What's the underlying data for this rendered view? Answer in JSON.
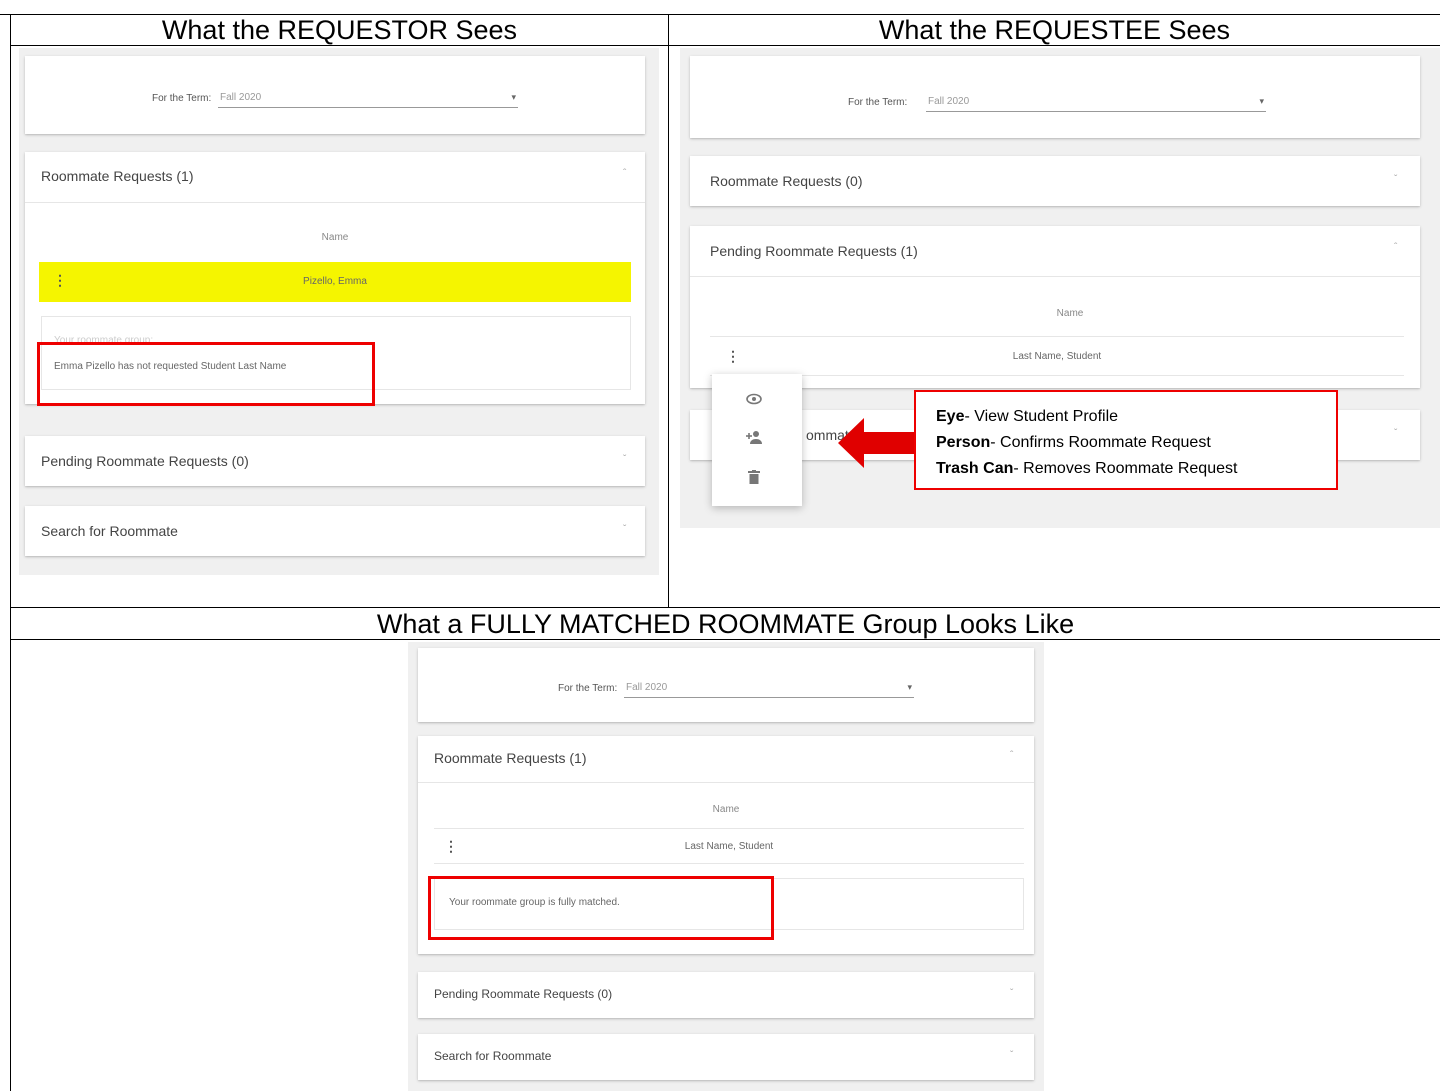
{
  "headings": {
    "requestor": "What the REQUESTOR Sees",
    "requestee": "What the REQUESTEE Sees",
    "matched": "What a FULLY MATCHED ROOMMATE Group Looks Like"
  },
  "requestor": {
    "term_label": "For the Term:",
    "term_value": "Fall 2020",
    "roommate_requests_title": "Roommate Requests (1)",
    "name_header": "Name",
    "row_name": "Pizello, Emma",
    "faded_text": "Your roommate group:",
    "status_message": "Emma Pizello has not requested Student Last Name",
    "pending_title": "Pending Roommate Requests (0)",
    "search_title": "Search for Roommate"
  },
  "requestee": {
    "term_label": "For the Term:",
    "term_value": "Fall 2020",
    "roommate_requests_title": "Roommate Requests (0)",
    "pending_title": "Pending Roommate Requests (1)",
    "name_header": "Name",
    "row_name": "Last Name, Student",
    "hidden_title_fragment": "ommat",
    "menu_icons": [
      "eye-icon",
      "person-add-icon",
      "trash-icon"
    ],
    "callout": {
      "eye_bold": "Eye",
      "eye_text": "- View Student Profile",
      "person_bold": "Person",
      "person_text": "- Confirms Roommate Request",
      "trash_bold": "Trash Can",
      "trash_text": "- Removes Roommate Request"
    }
  },
  "matched": {
    "term_label": "For the Term:",
    "term_value": "Fall 2020",
    "roommate_requests_title": "Roommate Requests (1)",
    "name_header": "Name",
    "row_name": "Last Name, Student",
    "status_message": "Your roommate group is fully matched.",
    "pending_title": "Pending Roommate Requests (0)",
    "search_title": "Search for Roommate"
  },
  "colors": {
    "highlight": "#f5f500",
    "annotation_red": "#e00000",
    "panel_bg": "#f0f0f0"
  }
}
